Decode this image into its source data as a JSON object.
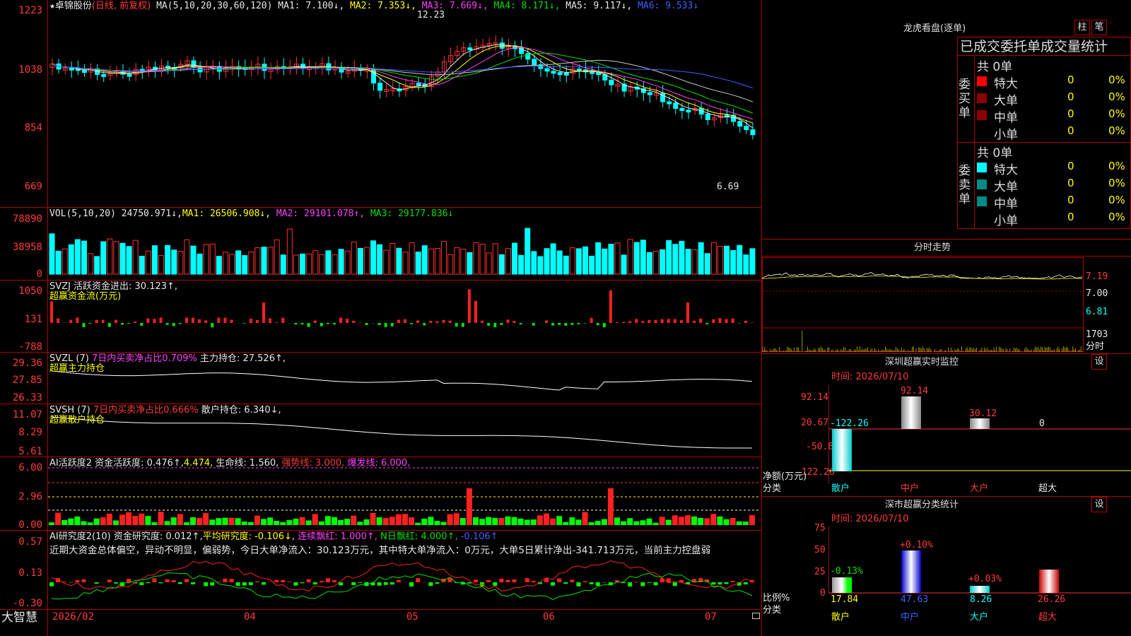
{
  "stock": {
    "name": "卓锦股份",
    "mode": "(日线, 前复权)",
    "ma_label": "MA(5,10,20,30,60,120)",
    "ma1": "MA1: 7.100↓,",
    "ma2": "MA2: 7.353↓,",
    "ma3": "MA3: 7.669↓,",
    "ma4": "MA4: 8.171↓,",
    "ma5": "MA5: 9.117↓,",
    "ma6": "MA6: 9.533↓",
    "high_mark": "12.23",
    "low_mark": "6.69"
  },
  "price_axis": [
    "1223",
    "1038",
    "854",
    "669"
  ],
  "vol": {
    "label": "VOL(5,10,20)",
    "value": "24750.971↓,",
    "ma1": "MA1: 26506.908↓,",
    "ma2": "MA2: 29101.078↑,",
    "ma3": "MA3: 29177.836↓",
    "axis": [
      "78890",
      "38958",
      "0"
    ]
  },
  "svzj": {
    "label": "SVZJ  活跃资金进出: 30.123↑,",
    "sub": "超赢资金流(万元)",
    "axis": [
      "1050",
      "131",
      "-788"
    ]
  },
  "svzl": {
    "label1": "SVZL (7)",
    "label2": "7日内买卖净占比0.709%",
    "label3": "主力持仓: 27.526↑,",
    "sub": "超赢主力持仓",
    "axis": [
      "29.36",
      "27.85",
      "26.33"
    ]
  },
  "svsh": {
    "label1": "SVSH (7)",
    "label2": "7日内买卖净占比0.666%",
    "label3": "散户持仓: 6.340↓,",
    "sub": "超赢散户持仓",
    "axis": [
      "11.07",
      "8.29",
      "5.61"
    ]
  },
  "ai_active": {
    "label1": "AI活跃度2",
    "label2": "资金活跃度: 0.476↑,",
    "label3": "4.474,",
    "label4": "生命线: 1.560,",
    "label5": "强势线: 3.000,",
    "label6": "爆发线: 6.000,",
    "axis": [
      "6.00",
      "2.96",
      "0.00"
    ]
  },
  "ai_research": {
    "label1": "AI研究度2(10)",
    "label2": "资金研究度: 0.012↑,",
    "label3": "平均研究度: -0.106↓,",
    "label4": "连续飘红: 1.000↑,",
    "label5": "N日飘红: 4.000↑,",
    "label6": "-0.106↑",
    "commentary": "近期大资金总体偏空，异动不明显，偏弱势，今日大单净流入：30.123万元，其中特大单净流入：0万元，大单5日累计净出-341.713万元，当前主力控盘弱",
    "axis": [
      "0.57",
      "0.13",
      "-0.30"
    ]
  },
  "xaxis": {
    "brand": "大智慧",
    "dates": [
      "2026/02",
      "04",
      "05",
      "06",
      "07"
    ]
  },
  "longhu": {
    "title": "龙虎看盘(逐单)",
    "btn1": "柱",
    "btn2": "笔",
    "header": "已成交委托单成交量统计",
    "buy_side": "委买单",
    "sell_side": "委卖单",
    "buy_total": "共 0单",
    "sell_total": "共 0单",
    "rows": [
      {
        "name": "特大",
        "count": "0",
        "pct": "0%"
      },
      {
        "name": "大单",
        "count": "0",
        "pct": "0%"
      },
      {
        "name": "中单",
        "count": "0",
        "pct": "0%"
      },
      {
        "name": "小单",
        "count": "0",
        "pct": "0%"
      }
    ],
    "colors": {
      "buy": [
        "#ff0000",
        "#8b0000",
        "#8b0000"
      ],
      "sell": [
        "#00ffff",
        "#008b8b",
        "#008b8b"
      ]
    }
  },
  "intraday": {
    "title": "分时走势",
    "axis": [
      "7.19",
      "7.00",
      "6.81",
      "1703",
      "分时"
    ]
  },
  "sz_monitor": {
    "title": "深圳超赢实时监控",
    "set": "设",
    "time": "时间: 2026/07/10",
    "axis": [
      "92.14",
      "20.67",
      "-50.8",
      "-122.26"
    ],
    "unit": "净额(万元)",
    "cat_label": "分类",
    "cats": [
      "散户",
      "中户",
      "大户",
      "超大"
    ],
    "values": [
      "-122.26",
      "92.14",
      "30.12",
      "0"
    ]
  },
  "sz_class": {
    "title": "深市超赢分类统计",
    "set": "设",
    "time": "时间: 2026/07/10",
    "axis": [
      "75",
      "50",
      "25",
      "0"
    ],
    "unit": "比例%",
    "cat_label": "分类",
    "cats": [
      "散户",
      "中户",
      "大户",
      "超大"
    ],
    "values": [
      "17.84",
      "47.63",
      "8.26",
      "26.26"
    ],
    "changes": [
      "-0.13%",
      "+0.10%",
      "+0.03%",
      ""
    ]
  }
}
